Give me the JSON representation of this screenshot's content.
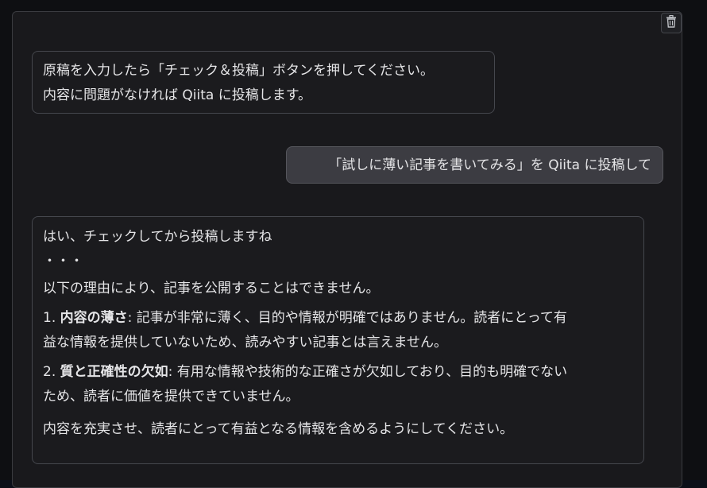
{
  "toolbar": {
    "trash_icon": "trash-icon"
  },
  "messages": {
    "bot_intro": {
      "line1": "原稿を入力したら「チェック＆投稿」ボタンを押してください。",
      "line2": "内容に問題がなければ Qiita に投稿します。"
    },
    "user_request": {
      "text": "「試しに薄い記事を書いてみる」を Qiita に投稿して"
    },
    "bot_reply": {
      "greeting": "はい、チェックしてから投稿しますね",
      "ellipsis": "・・・",
      "reason_intro": "以下の理由により、記事を公開することはできません。",
      "reasons": [
        {
          "number": "1.",
          "title": "内容の薄さ",
          "text_line1": ": 記事が非常に薄く、目的や情報が明確ではありません。読者にとって有",
          "text_line2": "益な情報を提供していないため、読みやすい記事とは言えません。"
        },
        {
          "number": "2.",
          "title": "質と正確性の欠如",
          "text_line1": ": 有用な情報や技術的な正確さが欠如しており、目的も明確でない",
          "text_line2": "ため、読者に価値を提供できていません。"
        }
      ],
      "closing": "内容を充実させ、読者にとって有益となる情報を含めるようにしてください。"
    }
  }
}
